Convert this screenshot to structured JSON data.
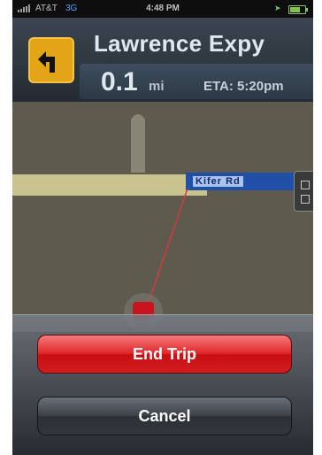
{
  "status_bar": {
    "carrier": "AT&T",
    "network": "3G",
    "time": "4:48 PM",
    "location_icon": "location-arrow-icon",
    "battery_icon": "battery-icon"
  },
  "navigation": {
    "turn_icon": "turn-left-arrow-icon",
    "street_name": "Lawrence Expy",
    "distance": "0.1",
    "distance_unit": "mi",
    "eta": "ETA: 5:20pm"
  },
  "map": {
    "road_label": "Kifer Rd",
    "colors": {
      "land": "#5e5b4e",
      "major_road": "#c9c48f",
      "route": "#1f4fa8",
      "route_line": "#d23a3a",
      "vehicle": "#c8141c"
    }
  },
  "action_sheet": {
    "end_trip_label": "End Trip",
    "cancel_label": "Cancel"
  }
}
